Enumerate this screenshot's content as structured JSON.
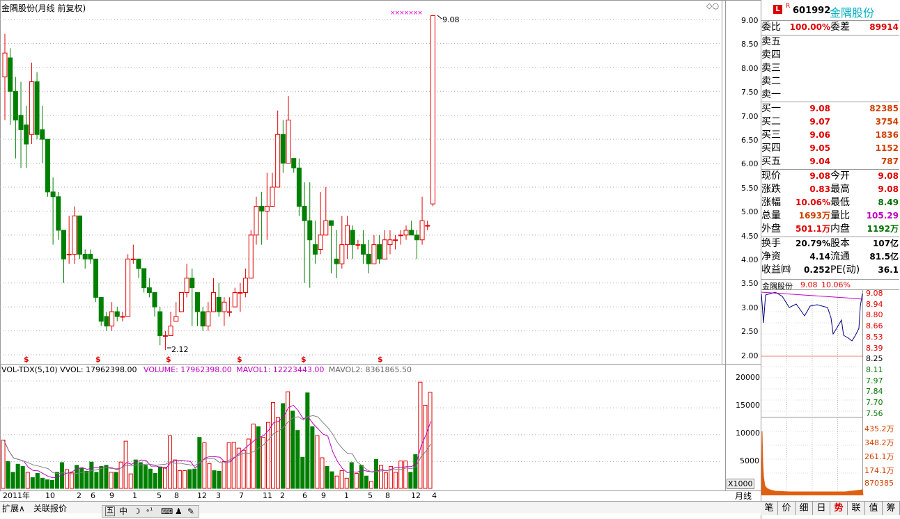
{
  "chart_header": {
    "title": "金隅股份(月线 前复权)",
    "max_label": "9.08",
    "min_label": "2.12",
    "dividend_marker": "$"
  },
  "price_axis": [
    "9.00",
    "8.50",
    "8.00",
    "7.50",
    "7.00",
    "6.50",
    "6.00",
    "5.50",
    "5.00",
    "4.50",
    "4.00",
    "3.50",
    "3.00",
    "2.50",
    "2.00"
  ],
  "vol_axis": [
    "20000",
    "15000",
    "10000",
    "5000"
  ],
  "vol_unit": "X1000",
  "vol_indicator": {
    "name": "VOL-TDX(5,10)",
    "vvol": "VVOL: 17962398.00",
    "volume": "VOLUME: 17962398.00",
    "mavol1": "MAVOL1: 12223443.00",
    "mavol2": "MAVOL2: 8361865.50"
  },
  "time_axis": [
    "2011年",
    "10",
    "2",
    "6",
    "9",
    "1",
    "5",
    "8",
    "12",
    "3",
    "7",
    "11",
    "2",
    "6",
    "9",
    "1",
    "5",
    "8",
    "12",
    "4"
  ],
  "period_label": "月线",
  "bottom_tabs": [
    "扩展∧",
    "关联报价"
  ],
  "toolbar_icons": [
    "五",
    "中",
    "moon-icon",
    "dots-icon",
    "keyboard-icon",
    "user-icon",
    "wrench-icon"
  ],
  "quote": {
    "badge_l": "L",
    "badge_r": "R",
    "code": "601992",
    "name": "金隅股份",
    "weibi_label": "委比",
    "weibi": "100.00%",
    "weicha_label": "委差",
    "weicha": "89914",
    "sell": [
      {
        "label": "卖五",
        "price": "",
        "vol": ""
      },
      {
        "label": "卖四",
        "price": "",
        "vol": ""
      },
      {
        "label": "卖三",
        "price": "",
        "vol": ""
      },
      {
        "label": "卖二",
        "price": "",
        "vol": ""
      },
      {
        "label": "卖一",
        "price": "",
        "vol": ""
      }
    ],
    "buy": [
      {
        "label": "买一",
        "price": "9.08",
        "vol": "82385"
      },
      {
        "label": "买二",
        "price": "9.07",
        "vol": "3754"
      },
      {
        "label": "买三",
        "price": "9.06",
        "vol": "1836"
      },
      {
        "label": "买四",
        "price": "9.05",
        "vol": "1152"
      },
      {
        "label": "买五",
        "price": "9.04",
        "vol": "787"
      }
    ],
    "stats1": [
      {
        "l1": "现价",
        "v1": "9.08",
        "l2": "今开",
        "v2": "9.08"
      },
      {
        "l1": "涨跌",
        "v1": "0.83",
        "l2": "最高",
        "v2": "9.08"
      },
      {
        "l1": "涨幅",
        "v1": "10.06%",
        "l2": "最低",
        "v2": "8.49"
      },
      {
        "l1": "总量",
        "v1": "1693万",
        "l2": "量比",
        "v2": "105.29"
      },
      {
        "l1": "外盘",
        "v1": "501.1万",
        "l2": "内盘",
        "v2": "1192万"
      }
    ],
    "stats2": [
      {
        "l1": "换手",
        "v1": "20.79%",
        "l2": "股本",
        "v2": "107亿"
      },
      {
        "l1": "净资",
        "v1": "4.14",
        "l2": "流通",
        "v2": "81.5亿"
      },
      {
        "l1": "收益㈣",
        "v1": "0.252",
        "l2": "PE(动)",
        "v2": "36.1"
      }
    ]
  },
  "mini_chart": {
    "title": "金隅股份",
    "price": "9.08",
    "pct": "10.06%",
    "price_axis": [
      "9.08",
      "8.94",
      "8.80",
      "8.66",
      "8.53",
      "8.39",
      "8.25",
      "8.11",
      "7.97",
      "7.84",
      "7.70",
      "7.56"
    ],
    "vol_axis": [
      "435.2万",
      "348.2万",
      "261.1万",
      "174.1万",
      "870385"
    ]
  },
  "right_tabs": [
    "笔",
    "价",
    "细",
    "日",
    "势",
    "联",
    "值",
    "筹"
  ],
  "colors": {
    "up": "#e00000",
    "down": "#008000",
    "ma1": "#c000c0",
    "ma2": "#808080",
    "grid": "#b0b0b0"
  },
  "chart_data": {
    "type": "candlestick",
    "title": "金隅股份(月线 前复权)",
    "ylim": [
      2.0,
      9.1
    ],
    "candles": [
      [
        7.8,
        8.3,
        8.7,
        6.9
      ],
      [
        8.2,
        7.5,
        8.4,
        6.8
      ],
      [
        7.5,
        6.9,
        7.8,
        6.1
      ],
      [
        7.0,
        6.7,
        7.7,
        5.9
      ],
      [
        6.8,
        6.4,
        7.2,
        5.9
      ],
      [
        6.6,
        7.7,
        8.1,
        6.4
      ],
      [
        7.7,
        6.6,
        7.9,
        6.5
      ],
      [
        6.7,
        6.5,
        7.2,
        6.0
      ],
      [
        6.5,
        5.4,
        6.5,
        5.3
      ],
      [
        5.4,
        5.3,
        5.7,
        4.3
      ],
      [
        5.3,
        4.6,
        5.4,
        4.4
      ],
      [
        4.6,
        4.0,
        4.6,
        3.5
      ],
      [
        4.1,
        4.1,
        4.9,
        3.9
      ],
      [
        4.1,
        4.9,
        5.1,
        3.9
      ],
      [
        4.9,
        4.1,
        4.9,
        4.0
      ],
      [
        4.1,
        4.0,
        4.2,
        3.8
      ],
      [
        4.1,
        4.0,
        4.2,
        3.9
      ],
      [
        4.0,
        3.2,
        4.0,
        3.1
      ],
      [
        3.2,
        2.7,
        3.2,
        2.6
      ],
      [
        2.8,
        2.6,
        2.9,
        2.5
      ],
      [
        2.6,
        2.9,
        3.1,
        2.5
      ],
      [
        2.9,
        2.8,
        3.0,
        2.7
      ],
      [
        2.8,
        2.8,
        2.9,
        2.7
      ],
      [
        2.8,
        4.0,
        4.1,
        2.8
      ],
      [
        4.0,
        4.0,
        4.3,
        3.9
      ],
      [
        4.0,
        3.8,
        4.0,
        3.6
      ],
      [
        3.8,
        3.4,
        3.8,
        3.3
      ],
      [
        3.4,
        3.3,
        3.6,
        3.2
      ],
      [
        3.3,
        3.0,
        3.3,
        2.8
      ],
      [
        2.9,
        2.4,
        3.0,
        2.2
      ],
      [
        2.4,
        2.4,
        2.5,
        2.1
      ],
      [
        2.4,
        2.6,
        2.9,
        2.4
      ],
      [
        2.7,
        2.8,
        3.1,
        2.7
      ],
      [
        2.9,
        3.3,
        3.3,
        2.9
      ],
      [
        3.3,
        3.6,
        3.9,
        3.2
      ],
      [
        3.6,
        3.4,
        3.8,
        2.6
      ],
      [
        3.3,
        2.9,
        3.3,
        2.6
      ],
      [
        2.9,
        2.6,
        3.0,
        2.5
      ],
      [
        2.6,
        2.9,
        3.1,
        2.5
      ],
      [
        2.9,
        3.3,
        3.6,
        2.9
      ],
      [
        3.2,
        2.9,
        3.5,
        2.8
      ],
      [
        2.9,
        3.1,
        3.2,
        2.6
      ],
      [
        2.9,
        2.9,
        3.2,
        2.8
      ],
      [
        3.0,
        3.3,
        3.4,
        3.0
      ],
      [
        3.3,
        3.3,
        3.5,
        2.9
      ],
      [
        3.3,
        3.6,
        3.8,
        3.2
      ],
      [
        3.6,
        4.5,
        4.6,
        3.6
      ],
      [
        4.5,
        5.1,
        5.3,
        4.3
      ],
      [
        5.1,
        5.0,
        5.4,
        4.3
      ],
      [
        5.0,
        5.1,
        5.8,
        4.4
      ],
      [
        5.1,
        5.5,
        5.8,
        5.1
      ],
      [
        5.5,
        6.6,
        7.1,
        5.5
      ],
      [
        6.6,
        6.0,
        6.9,
        5.8
      ],
      [
        6.0,
        6.9,
        7.4,
        6.0
      ],
      [
        6.1,
        5.9,
        6.0,
        5.8
      ],
      [
        5.9,
        5.1,
        6.1,
        4.9
      ],
      [
        5.1,
        4.8,
        5.6,
        3.5
      ],
      [
        4.8,
        4.4,
        5.6,
        3.4
      ],
      [
        4.3,
        4.1,
        4.8,
        3.9
      ],
      [
        4.2,
        4.5,
        5.4,
        4.1
      ],
      [
        4.5,
        4.8,
        5.5,
        4.5
      ],
      [
        4.8,
        4.7,
        4.8,
        3.7
      ],
      [
        4.0,
        3.9,
        4.6,
        3.6
      ],
      [
        3.9,
        4.3,
        4.9,
        3.8
      ],
      [
        4.3,
        4.7,
        4.9,
        4.0
      ],
      [
        4.6,
        4.3,
        4.7,
        4.0
      ],
      [
        4.3,
        4.3,
        4.4,
        4.2
      ],
      [
        4.3,
        4.1,
        4.6,
        3.9
      ],
      [
        4.1,
        3.9,
        4.4,
        3.7
      ],
      [
        3.9,
        4.3,
        4.5,
        3.9
      ],
      [
        4.3,
        4.0,
        4.5,
        3.9
      ],
      [
        4.0,
        4.4,
        4.6,
        4.0
      ],
      [
        4.3,
        4.4,
        4.6,
        4.1
      ],
      [
        4.4,
        4.4,
        4.5,
        4.2
      ],
      [
        4.5,
        4.5,
        4.6,
        4.3
      ],
      [
        4.5,
        4.6,
        4.7,
        4.4
      ],
      [
        4.6,
        4.5,
        4.8,
        4.5
      ],
      [
        4.5,
        4.4,
        4.6,
        4.0
      ],
      [
        4.4,
        4.8,
        5.3,
        4.3
      ],
      [
        4.7,
        4.7,
        4.8,
        4.6
      ],
      [
        5.15,
        9.08,
        9.08,
        5.1
      ]
    ],
    "volumes": [
      9000,
      5000,
      3000,
      4500,
      4100,
      3000,
      2000,
      2800,
      1900,
      1600,
      1500,
      3000,
      4800,
      3500,
      2900,
      4300,
      3800,
      3200,
      4900,
      3000,
      4100,
      4300,
      3000,
      3000,
      4900,
      8800,
      2700,
      5300,
      4800,
      4300,
      3600,
      2800,
      4000,
      3900,
      9800,
      5300,
      3300,
      3300,
      3500,
      3600,
      9500,
      8500,
      4600,
      3300,
      3200,
      5000,
      8500,
      8600,
      7500,
      7100,
      9200,
      12000,
      11500,
      9500,
      12300,
      16000,
      13200,
      15800,
      18000,
      14400,
      10800,
      5800,
      17800,
      11500,
      9800,
      5700,
      4100,
      3100,
      2300,
      3300,
      1900,
      4800,
      2800,
      4300,
      2300,
      1300,
      5400,
      4300,
      2900,
      4100,
      3000,
      5100,
      5100,
      3000,
      6300,
      19800,
      15500,
      17900
    ],
    "vol_ylim": [
      0,
      21000
    ]
  }
}
